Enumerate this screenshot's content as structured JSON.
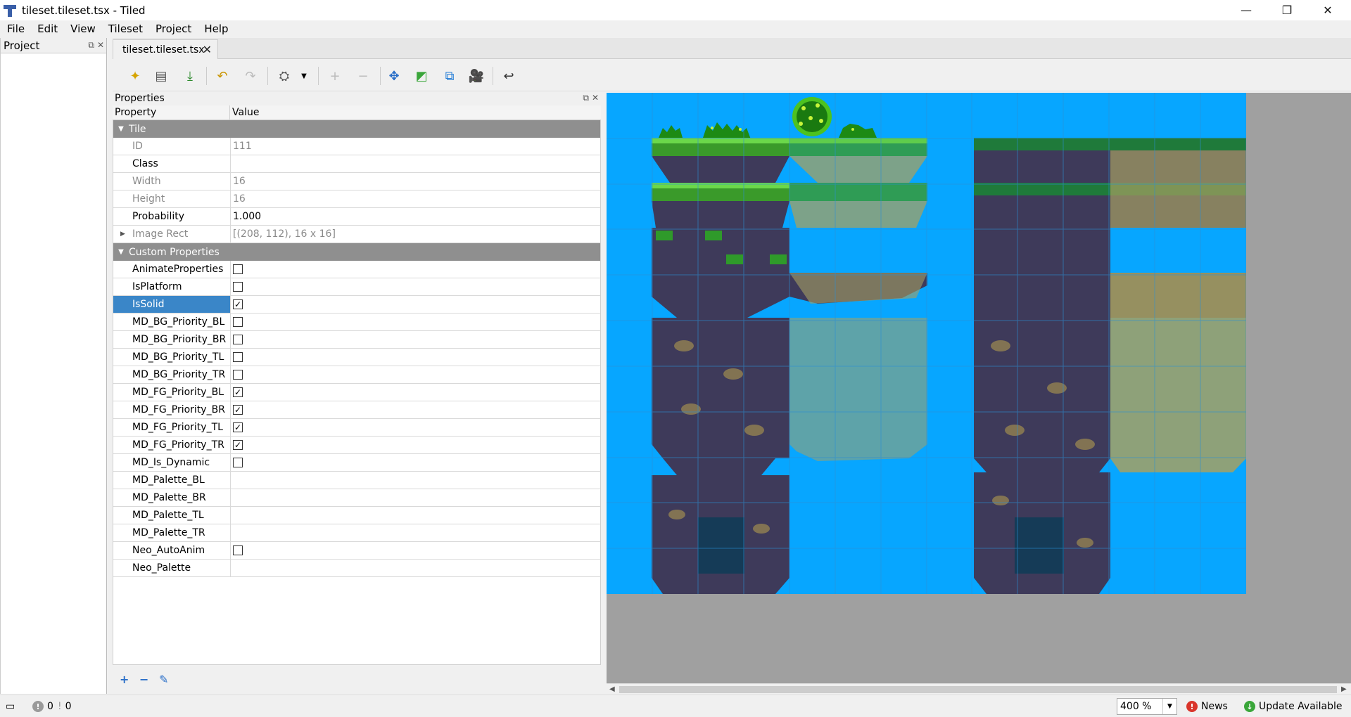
{
  "window": {
    "title": "tileset.tileset.tsx - Tiled",
    "minimize": "—",
    "restore": "❐",
    "close": "✕"
  },
  "menu": [
    "File",
    "Edit",
    "View",
    "Tileset",
    "Project",
    "Help"
  ],
  "project_dock": {
    "title": "Project"
  },
  "tabs": [
    {
      "label": "tileset.tileset.tsx",
      "close": "✕"
    }
  ],
  "properties": {
    "title": "Properties",
    "header": {
      "property": "Property",
      "value": "Value"
    },
    "groups": [
      {
        "name": "Tile",
        "rows": [
          {
            "name": "ID",
            "value": "111",
            "readonly": true
          },
          {
            "name": "Class",
            "value": "",
            "readonly": false
          },
          {
            "name": "Width",
            "value": "16",
            "readonly": true
          },
          {
            "name": "Height",
            "value": "16",
            "readonly": true
          },
          {
            "name": "Probability",
            "value": "1.000",
            "readonly": false
          },
          {
            "name": "Image Rect",
            "value": "[(208, 112), 16 x 16]",
            "readonly": true,
            "expandable": true
          }
        ]
      },
      {
        "name": "Custom Properties",
        "rows": [
          {
            "name": "AnimateProperties",
            "checkbox": true,
            "checked": false
          },
          {
            "name": "IsPlatform",
            "checkbox": true,
            "checked": false
          },
          {
            "name": "IsSolid",
            "checkbox": true,
            "checked": true,
            "selected": true
          },
          {
            "name": "MD_BG_Priority_BL",
            "checkbox": true,
            "checked": false
          },
          {
            "name": "MD_BG_Priority_BR",
            "checkbox": true,
            "checked": false
          },
          {
            "name": "MD_BG_Priority_TL",
            "checkbox": true,
            "checked": false
          },
          {
            "name": "MD_BG_Priority_TR",
            "checkbox": true,
            "checked": false
          },
          {
            "name": "MD_FG_Priority_BL",
            "checkbox": true,
            "checked": true
          },
          {
            "name": "MD_FG_Priority_BR",
            "checkbox": true,
            "checked": true
          },
          {
            "name": "MD_FG_Priority_TL",
            "checkbox": true,
            "checked": true
          },
          {
            "name": "MD_FG_Priority_TR",
            "checkbox": true,
            "checked": true
          },
          {
            "name": "MD_Is_Dynamic",
            "checkbox": true,
            "checked": false
          },
          {
            "name": "MD_Palette_BL",
            "value": ""
          },
          {
            "name": "MD_Palette_BR",
            "value": ""
          },
          {
            "name": "MD_Palette_TL",
            "value": ""
          },
          {
            "name": "MD_Palette_TR",
            "value": ""
          },
          {
            "name": "Neo_AutoAnim",
            "checkbox": true,
            "checked": false
          },
          {
            "name": "Neo_Palette",
            "value": ""
          }
        ]
      }
    ],
    "buttons": {
      "add": "+",
      "remove": "−",
      "rename": "✎"
    }
  },
  "toolbar": [
    {
      "name": "new-tileset-icon",
      "glyph": "✦",
      "color": "#d6a400"
    },
    {
      "name": "open-icon",
      "glyph": "▤",
      "color": "#555555"
    },
    {
      "name": "save-icon",
      "glyph": "⤓",
      "color": "#2d8a2d"
    },
    {
      "name": "undo-icon",
      "glyph": "↶",
      "color": "#c99400"
    },
    {
      "name": "redo-icon",
      "glyph": "↷",
      "color": "#bbbbbb"
    },
    {
      "name": "dynamic-wrapping-icon",
      "glyph": "⛭",
      "color": "#555555"
    },
    {
      "name": "add-tiles-icon",
      "glyph": "+",
      "color": "#bbbbbb"
    },
    {
      "name": "remove-tiles-icon",
      "glyph": "−",
      "color": "#bbbbbb"
    },
    {
      "name": "edit-collision-icon",
      "glyph": "✥",
      "color": "#2a6fc8"
    },
    {
      "name": "terrain-sets-icon",
      "glyph": "◩",
      "color": "#3aa63a"
    },
    {
      "name": "edit-collision-shapes-icon",
      "glyph": "⧉",
      "color": "#1f7ad6"
    },
    {
      "name": "animation-editor-icon",
      "glyph": "🎥",
      "color": "#111111"
    },
    {
      "name": "back-icon",
      "glyph": "↩",
      "color": "#333333"
    }
  ],
  "status": {
    "errors": "0",
    "warnings": "0",
    "zoom": "400 %",
    "news": "News",
    "update": "Update Available"
  },
  "colors": {
    "sky": "#07a6ff",
    "canvas_bg": "#a0a0a0",
    "selection": "#3a86c8",
    "group_header": "#8f8f8f"
  }
}
